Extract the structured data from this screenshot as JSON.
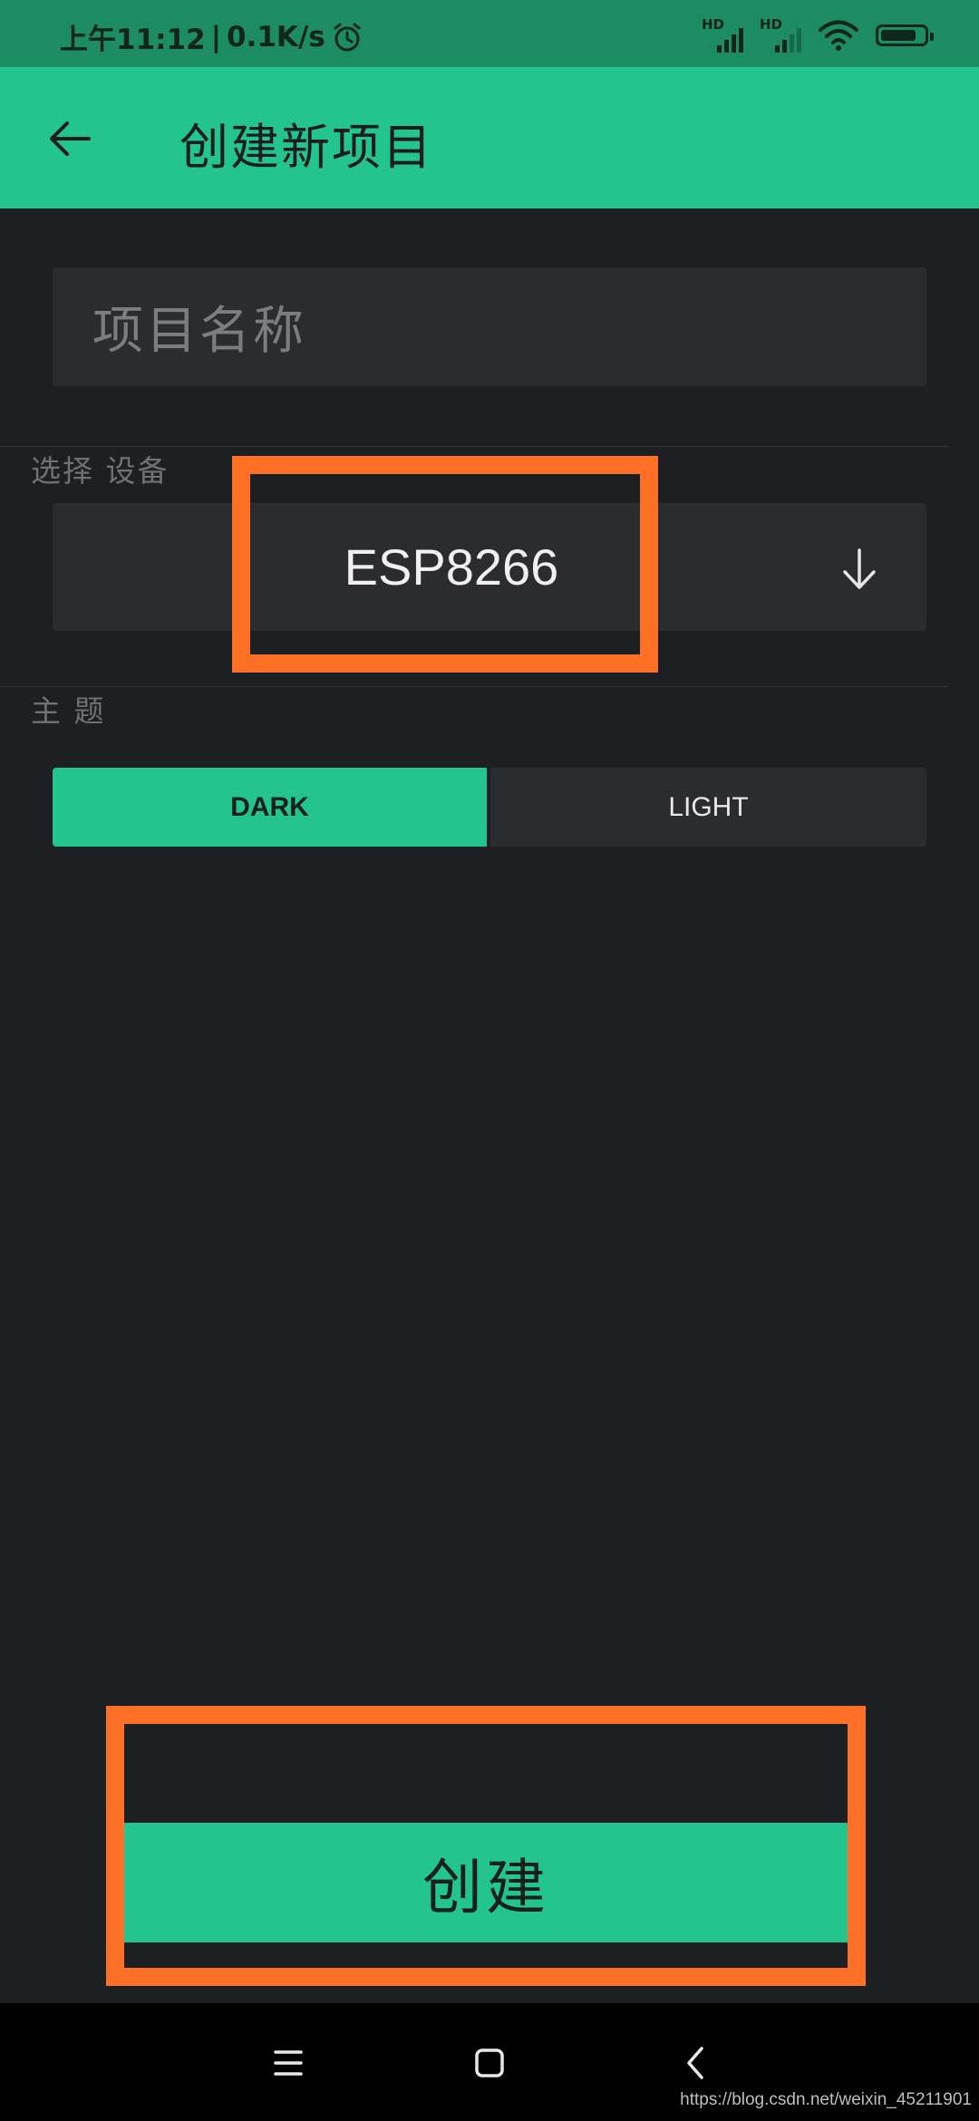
{
  "status_bar": {
    "time": "上午11:12",
    "separator": "|",
    "net_speed": "0.1K/s",
    "alarm_icon": "alarm-clock-icon",
    "sim1_label": "HD",
    "sim2_label": "HD",
    "wifi_icon": "wifi-icon",
    "battery_icon": "battery-icon"
  },
  "app_bar": {
    "back_icon": "arrow-left-icon",
    "title": "创建新项目"
  },
  "form": {
    "name_placeholder": "项目名称",
    "device_label": "选择 设备",
    "device_value": "ESP8266",
    "device_arrow_icon": "arrow-down-icon",
    "theme_label": "主 题",
    "theme_options": [
      "DARK",
      "LIGHT"
    ],
    "theme_selected": "DARK",
    "create_label": "创建"
  },
  "nav_bar": {
    "icons": [
      "menu-icon",
      "home-square-icon",
      "back-chevron-icon"
    ]
  },
  "watermark": "https://blog.csdn.net/weixin_45211901",
  "colors": {
    "accent": "#23c48e",
    "status_bar": "#1d8c63",
    "background": "#1e1f23",
    "field": "#2b2c30",
    "highlight": "#fe7025"
  }
}
